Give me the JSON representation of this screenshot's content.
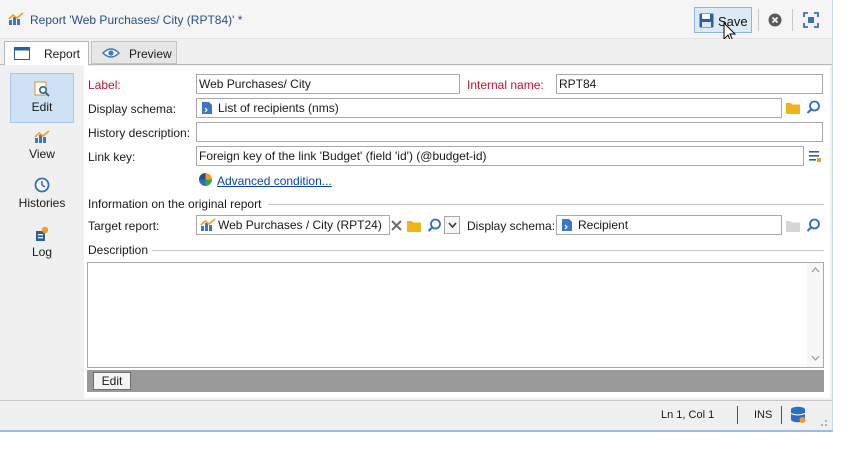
{
  "window": {
    "title": "Report 'Web Purchases/ City (RPT84)' *",
    "save_label": "Save"
  },
  "tabs": [
    {
      "label": "Report",
      "active": true
    },
    {
      "label": "Preview",
      "active": false
    }
  ],
  "nav": [
    {
      "label": "Edit",
      "icon": "edit-magnifier-icon",
      "selected": true
    },
    {
      "label": "View",
      "icon": "chart-icon",
      "selected": false
    },
    {
      "label": "Histories",
      "icon": "history-clock-icon",
      "selected": false
    },
    {
      "label": "Log",
      "icon": "log-icon",
      "selected": false
    }
  ],
  "form": {
    "label_label": "Label:",
    "label_value": "Web Purchases/ City",
    "internal_name_label": "Internal name:",
    "internal_name_value": "RPT84",
    "display_schema_label": "Display schema:",
    "display_schema_value": "List of recipients (nms)",
    "history_description_label": "History description:",
    "history_description_value": "",
    "link_key_label": "Link key:",
    "link_key_value": "Foreign key of the link 'Budget' (field 'id') (@budget-id)",
    "advanced_condition": "Advanced condition...",
    "original_report_group": "Information on the original report",
    "target_report_label": "Target report:",
    "target_report_value": "Web Purchases / City (RPT24)",
    "display_schema2_label": "Display schema:",
    "display_schema2_value": "Recipient",
    "description_label": "Description",
    "description_value": "",
    "edit_tab": "Edit"
  },
  "status": {
    "position": "Ln 1, Col 1",
    "mode": "INS"
  },
  "colors": {
    "accent": "#2a4f86",
    "required_label": "#c8102e",
    "link": "#0645ad",
    "selected_nav": "#cfe1f5"
  }
}
